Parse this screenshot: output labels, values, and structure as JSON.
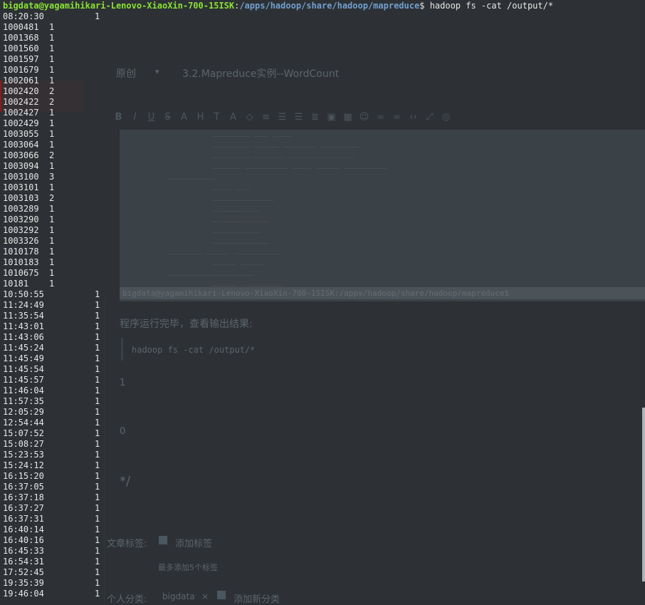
{
  "colors": {
    "background": "#2d3135",
    "prompt_user": "#8ae234",
    "prompt_path": "#729fcf",
    "text": "#e6e6e6"
  },
  "terminal": {
    "prompt": {
      "user_host": "bigdata@yagamihikari-Lenovo-XiaoXin-700-15ISK",
      "separator": ":",
      "path": "/apps/hadoop/share/hadoop/mapreduce",
      "symbol": "$",
      "command": "hadoop fs -cat /output/*"
    },
    "rows": [
      {
        "key": "08:20:30",
        "count": "1"
      },
      {
        "key": "1000481",
        "count": "1"
      },
      {
        "key": "1001368",
        "count": "1"
      },
      {
        "key": "1001560",
        "count": "1"
      },
      {
        "key": "1001597",
        "count": "1"
      },
      {
        "key": "1001679",
        "count": "1"
      },
      {
        "key": "1002061",
        "count": "1"
      },
      {
        "key": "1002420",
        "count": "2"
      },
      {
        "key": "1002422",
        "count": "2"
      },
      {
        "key": "1002427",
        "count": "1"
      },
      {
        "key": "1002429",
        "count": "1"
      },
      {
        "key": "1003055",
        "count": "1"
      },
      {
        "key": "1003064",
        "count": "1"
      },
      {
        "key": "1003066",
        "count": "2"
      },
      {
        "key": "1003094",
        "count": "1"
      },
      {
        "key": "1003100",
        "count": "3"
      },
      {
        "key": "1003101",
        "count": "1"
      },
      {
        "key": "1003103",
        "count": "2"
      },
      {
        "key": "1003289",
        "count": "1"
      },
      {
        "key": "1003290",
        "count": "1"
      },
      {
        "key": "1003292",
        "count": "1"
      },
      {
        "key": "1003326",
        "count": "1"
      },
      {
        "key": "1010178",
        "count": "1"
      },
      {
        "key": "1010183",
        "count": "1"
      },
      {
        "key": "1010675",
        "count": "1"
      },
      {
        "key": "10181",
        "count": "1"
      },
      {
        "key": "10:50:55",
        "count": "1"
      },
      {
        "key": "11:24:49",
        "count": "1"
      },
      {
        "key": "11:35:54",
        "count": "1"
      },
      {
        "key": "11:43:01",
        "count": "1"
      },
      {
        "key": "11:43:06",
        "count": "1"
      },
      {
        "key": "11:45:24",
        "count": "1"
      },
      {
        "key": "11:45:49",
        "count": "1"
      },
      {
        "key": "11:45:54",
        "count": "1"
      },
      {
        "key": "11:45:57",
        "count": "1"
      },
      {
        "key": "11:46:04",
        "count": "1"
      },
      {
        "key": "11:57:35",
        "count": "1"
      },
      {
        "key": "12:05:29",
        "count": "1"
      },
      {
        "key": "12:54:44",
        "count": "1"
      },
      {
        "key": "15:07:52",
        "count": "1"
      },
      {
        "key": "15:08:27",
        "count": "1"
      },
      {
        "key": "15:23:53",
        "count": "1"
      },
      {
        "key": "15:24:12",
        "count": "1"
      },
      {
        "key": "16:15:20",
        "count": "1"
      },
      {
        "key": "16:37:05",
        "count": "1"
      },
      {
        "key": "16:37:18",
        "count": "1"
      },
      {
        "key": "16:37:27",
        "count": "1"
      },
      {
        "key": "16:37:31",
        "count": "1"
      },
      {
        "key": "16:40:14",
        "count": "1"
      },
      {
        "key": "16:40:16",
        "count": "1"
      },
      {
        "key": "16:45:33",
        "count": "1"
      },
      {
        "key": "16:54:31",
        "count": "1"
      },
      {
        "key": "17:52:45",
        "count": "1"
      },
      {
        "key": "19:35:39",
        "count": "1"
      },
      {
        "key": "19:46:04",
        "count": "1"
      }
    ]
  },
  "background_editor": {
    "category": "原创",
    "title": "3.2.Mapreduce实例--WordCount",
    "toolbar_icons": [
      "bold-icon",
      "italic-icon",
      "underline-icon",
      "strikethrough-icon",
      "heading-icon",
      "heading-icon",
      "text-size-icon",
      "font-color-icon",
      "highlight-icon",
      "align-left-icon",
      "list-icon",
      "list-ordered-icon",
      "indent-icon",
      "image-icon",
      "table-icon",
      "emoji-icon",
      "link-icon",
      "unlink-icon",
      "code-icon",
      "fullscreen-icon",
      "help-icon"
    ],
    "code_block_highlight": "bigdata@yagamihikari-Lenovo-XiaoXin-700-15ISK:/apps/hadoop/share/hadoop/mapreduce$",
    "result_paragraph": "程序运行完毕，查看输出结果:",
    "inline_code": "hadoop fs -cat /output/*",
    "num_one": "1",
    "num_zero": "0",
    "comment_end": "*/",
    "tag_label": "文章标签:",
    "tag_add": "添加标签",
    "tag_hint": "最多添加5个标签",
    "category_label": "个人分类:",
    "category_value": "bigdata",
    "category_close": "×",
    "category_add": "添加新分类"
  }
}
